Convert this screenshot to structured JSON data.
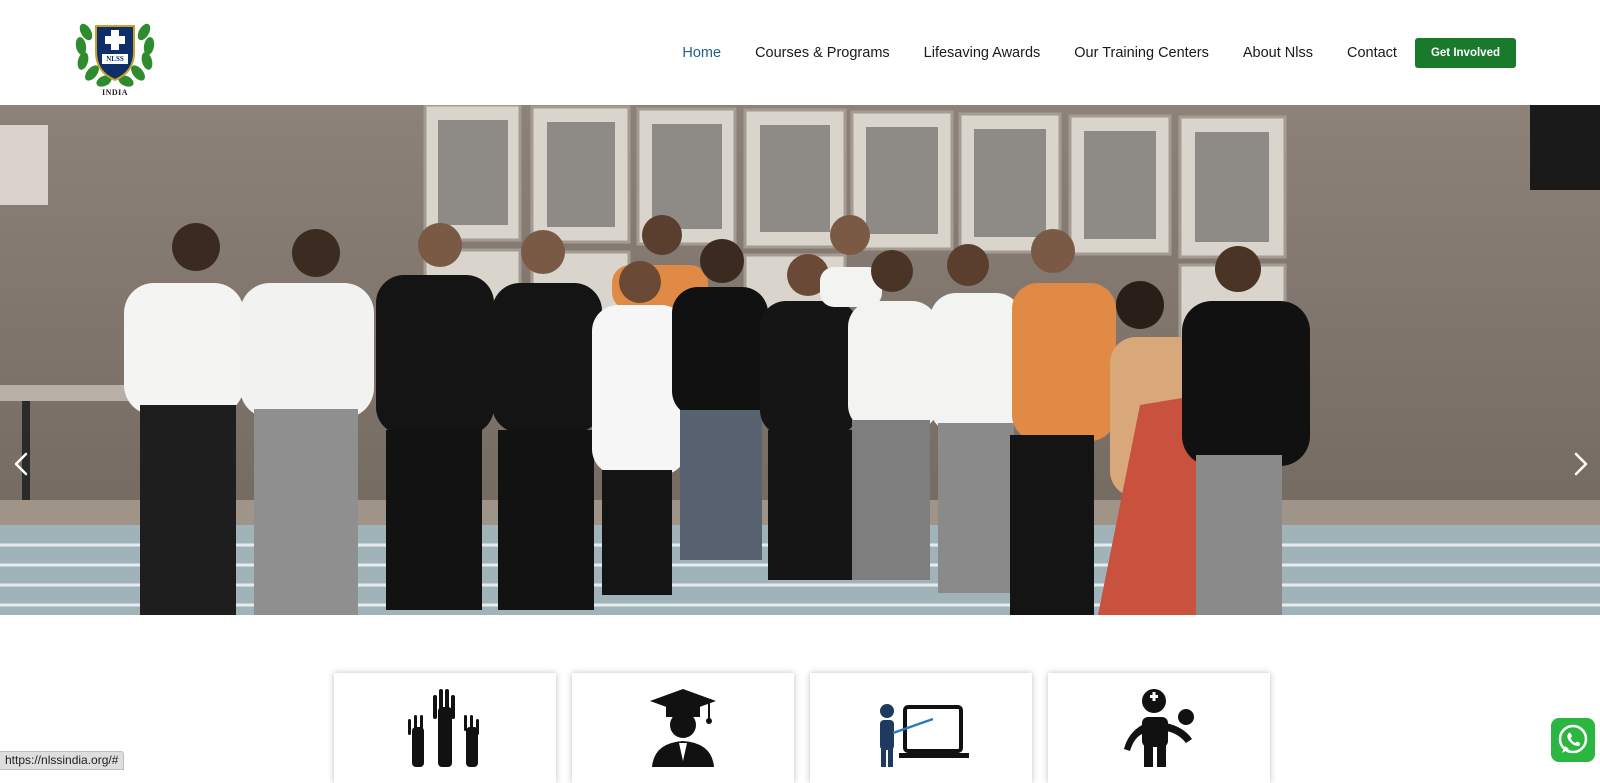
{
  "header": {
    "logo_text": "NLSS",
    "logo_caption": "INDIA",
    "nav": [
      {
        "label": "Home",
        "active": true
      },
      {
        "label": "Courses & Programs",
        "active": false
      },
      {
        "label": "Lifesaving Awards",
        "active": false
      },
      {
        "label": "Our Training Centers",
        "active": false
      },
      {
        "label": "About Nlss",
        "active": false
      },
      {
        "label": "Contact",
        "active": false
      }
    ],
    "cta_label": "Get Involved"
  },
  "hero": {
    "image": "group-photo",
    "prev_icon": "chevron-left-icon",
    "next_icon": "chevron-right-icon"
  },
  "feature_cards": [
    {
      "icon": "raised-hands-icon"
    },
    {
      "icon": "graduate-icon"
    },
    {
      "icon": "trainer-presentation-icon"
    },
    {
      "icon": "lifeguard-rescue-icon"
    }
  ],
  "status_bar": {
    "url": "https://nlssindia.org/#"
  },
  "colors": {
    "accent_green": "#1a7a2b",
    "active_nav": "#1f5f8b",
    "whatsapp": "#2ab640"
  }
}
